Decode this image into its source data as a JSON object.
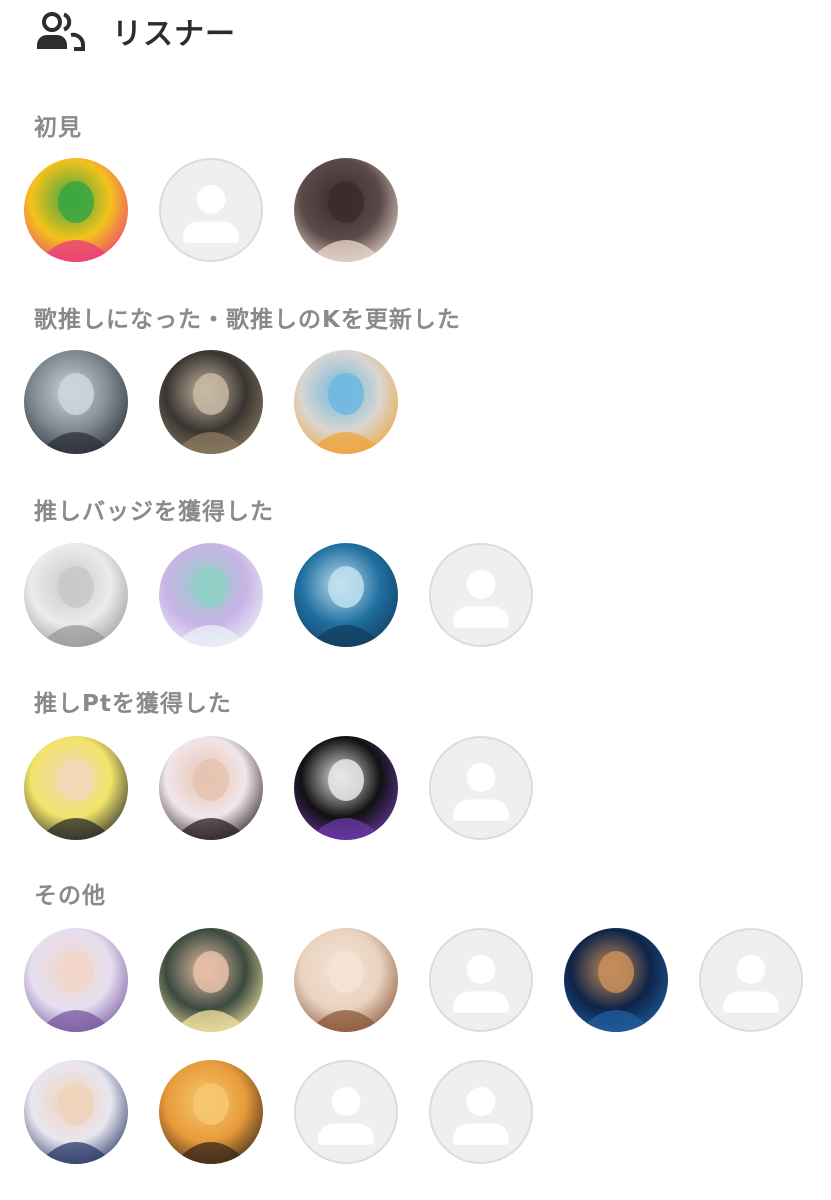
{
  "header": {
    "icon": "users-icon",
    "title": "リスナー"
  },
  "sections": [
    {
      "key": "first",
      "title": "初見",
      "avatars": [
        {
          "type": "photo",
          "name": "avatar-senbei-team",
          "colors": [
            "#f5c21b",
            "#e93a7d",
            "#3aa541"
          ]
        },
        {
          "type": "placeholder",
          "name": "avatar-placeholder"
        },
        {
          "type": "photo",
          "name": "avatar-girl-rabbit",
          "colors": [
            "#5b4a49",
            "#e9d8cc",
            "#3b2b2b"
          ]
        }
      ]
    },
    {
      "key": "uta",
      "title": "歌推しになった・歌推しのKを更新した",
      "avatars": [
        {
          "type": "photo",
          "name": "avatar-jump-group",
          "colors": [
            "#7c8790",
            "#2c3038",
            "#cfd6dc"
          ]
        },
        {
          "type": "photo",
          "name": "avatar-guitar",
          "colors": [
            "#3a3532",
            "#8c7a60",
            "#c7b9a3"
          ]
        },
        {
          "type": "photo",
          "name": "avatar-rainbow-drawing",
          "colors": [
            "#d9d6d1",
            "#f0a33b",
            "#6fb7e0"
          ]
        }
      ]
    },
    {
      "key": "badge",
      "title": "推しバッジを獲得した",
      "avatars": [
        {
          "type": "photo",
          "name": "avatar-sketch-girl",
          "colors": [
            "#ecebea",
            "#9a9a9a",
            "#c8c8c8"
          ]
        },
        {
          "type": "photo",
          "name": "avatar-anime-catgirl",
          "colors": [
            "#c9b3e6",
            "#e9f2f6",
            "#8fd0c6"
          ]
        },
        {
          "type": "photo",
          "name": "avatar-card-blue",
          "colors": [
            "#1f6fa0",
            "#123d5e",
            "#bfe0f0"
          ]
        },
        {
          "type": "placeholder",
          "name": "avatar-placeholder"
        }
      ]
    },
    {
      "key": "pt",
      "title": "推しPtを獲得した",
      "avatars": [
        {
          "type": "photo",
          "name": "avatar-anime-boy-glasses",
          "colors": [
            "#f2e36a",
            "#2b2b2b",
            "#f3d7bb"
          ]
        },
        {
          "type": "photo",
          "name": "avatar-idol-girl",
          "colors": [
            "#f1e6ea",
            "#2a2222",
            "#e7c2b0"
          ]
        },
        {
          "type": "photo",
          "name": "avatar-aoringo-gundan",
          "colors": [
            "#111111",
            "#6b39a8",
            "#e8e8e8"
          ]
        },
        {
          "type": "placeholder",
          "name": "avatar-placeholder"
        }
      ]
    },
    {
      "key": "other",
      "title": "その他",
      "avatars": [
        {
          "type": "photo",
          "name": "avatar-aradon",
          "colors": [
            "#e6dff0",
            "#7a5aa0",
            "#f1d6c8"
          ]
        },
        {
          "type": "photo",
          "name": "avatar-blonde-girl",
          "colors": [
            "#3b4a3f",
            "#f3e3a0",
            "#e8c0a8"
          ]
        },
        {
          "type": "photo",
          "name": "avatar-anime-girl-brown",
          "colors": [
            "#e9d3c0",
            "#8b5a3a",
            "#f6e3d6"
          ]
        },
        {
          "type": "placeholder",
          "name": "avatar-placeholder"
        },
        {
          "type": "photo",
          "name": "avatar-night-beach-glasses",
          "colors": [
            "#0e2348",
            "#1f5ea0",
            "#c88e5a"
          ]
        },
        {
          "type": "placeholder",
          "name": "avatar-placeholder"
        },
        {
          "type": "photo",
          "name": "avatar-detective-anime",
          "colors": [
            "#e8e6f0",
            "#2c3b6a",
            "#f0d2b8"
          ]
        },
        {
          "type": "photo",
          "name": "avatar-piano-sunset",
          "colors": [
            "#e89a3a",
            "#3a2a1a",
            "#f6c870"
          ]
        },
        {
          "type": "placeholder",
          "name": "avatar-placeholder"
        },
        {
          "type": "placeholder",
          "name": "avatar-placeholder"
        }
      ]
    }
  ]
}
